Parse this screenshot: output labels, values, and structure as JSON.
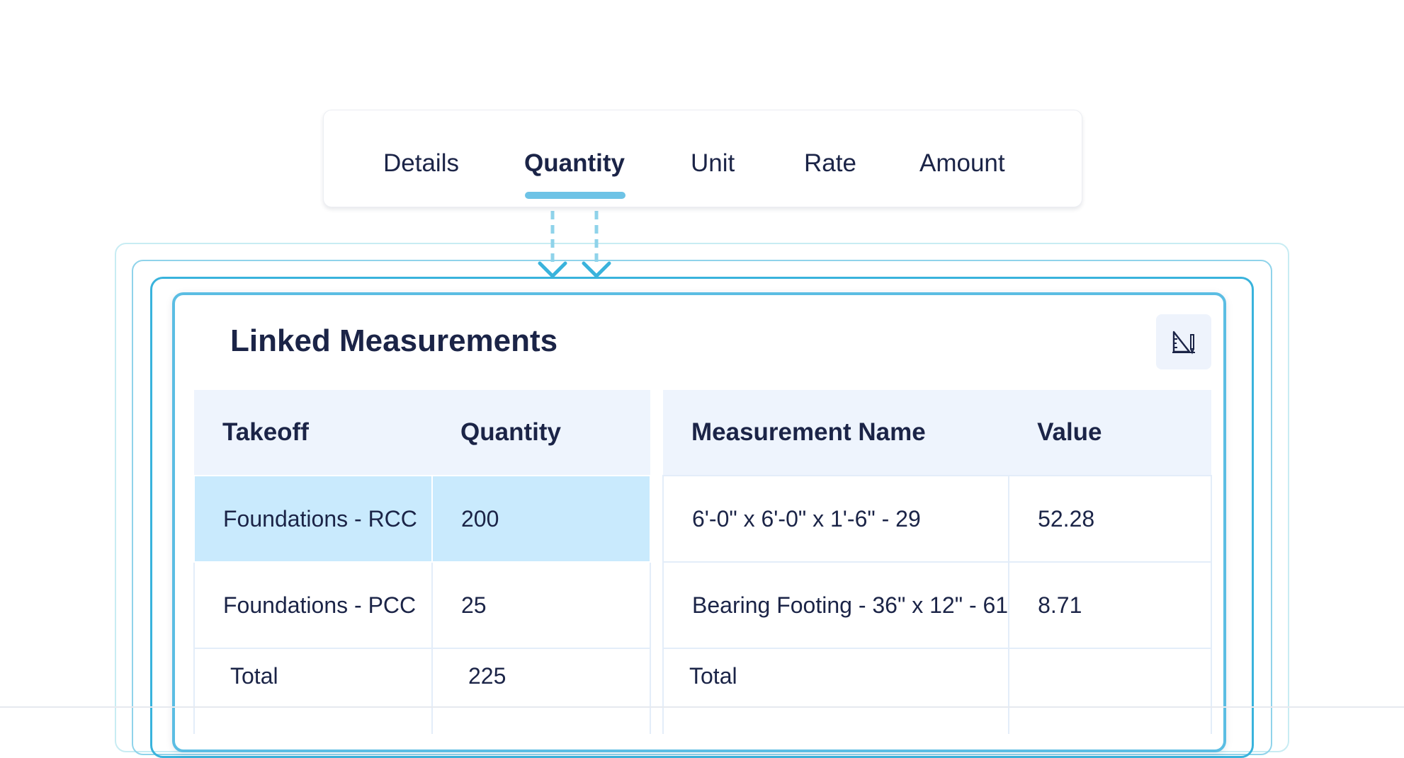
{
  "tabs": [
    {
      "label": "Details",
      "active": false
    },
    {
      "label": "Quantity",
      "active": true
    },
    {
      "label": "Unit",
      "active": false
    },
    {
      "label": "Rate",
      "active": false
    },
    {
      "label": "Amount",
      "active": false
    }
  ],
  "panel": {
    "title": "Linked Measurements",
    "tool_icon": "measure-tool-icon"
  },
  "takeoff_table": {
    "headers": [
      "Takeoff",
      "Quantity"
    ],
    "rows": [
      {
        "takeoff": "Foundations - RCC",
        "quantity": "200",
        "selected": true
      },
      {
        "takeoff": "Foundations - PCC",
        "quantity": "25",
        "selected": false
      }
    ],
    "total_label": "Total",
    "total_value": "225"
  },
  "measurement_table": {
    "headers": [
      "Measurement Name",
      "Value"
    ],
    "rows": [
      {
        "name": "6'-0\" x 6'-0\" x 1'-6\" - 29",
        "value": "52.28"
      },
      {
        "name": "Bearing Footing - 36\" x 12\" - 61",
        "value": "8.71"
      }
    ],
    "total_label": "Total",
    "total_value": ""
  },
  "colors": {
    "accent": "#5bbde3",
    "selected_row": "#c9eafd",
    "header_bg": "#eef4fd",
    "text": "#1b2447"
  }
}
